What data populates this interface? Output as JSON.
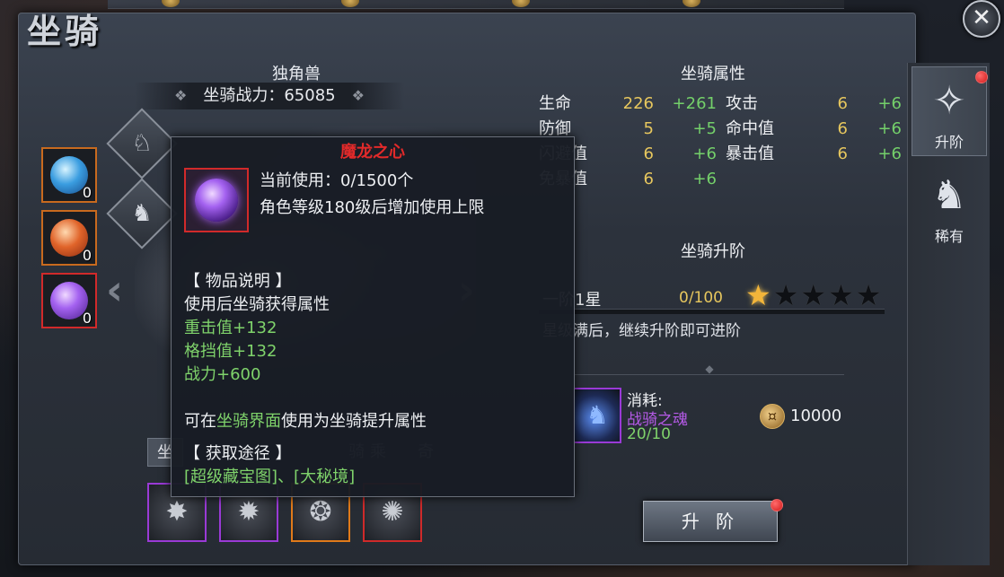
{
  "window": {
    "title": "坐骑",
    "close_glyph": "✕"
  },
  "colors": {
    "accent_gold": "#e7c75e",
    "bonus_green": "#74d06a",
    "tooltip_title_red": "#e22a2a",
    "notification_red": "#d21a1a"
  },
  "tabs": [
    {
      "label": "升阶",
      "icon": "rank-up-icon",
      "active": true,
      "badge": true
    },
    {
      "label": "稀有",
      "icon": "unicorn-icon",
      "active": false,
      "badge": false
    }
  ],
  "mount": {
    "name": "独角兽",
    "power_label": "坐骑战力：65085"
  },
  "consumables": [
    {
      "icon": "blue-orb-icon",
      "count": "0"
    },
    {
      "icon": "orange-orb-icon",
      "count": "0"
    },
    {
      "icon": "purple-orb-icon",
      "count": "0"
    }
  ],
  "mode_tabs": [
    {
      "label": "坐",
      "active": true
    },
    {
      "label": "骑 乘",
      "active": false
    },
    {
      "label": "奇",
      "active": false
    }
  ],
  "skills": [
    {
      "icon": "wolf-skill-icon",
      "rarity": "purple"
    },
    {
      "icon": "beast-skill-icon",
      "rarity": "purple"
    },
    {
      "icon": "wings-skill-icon",
      "rarity": "orange"
    },
    {
      "icon": "dragon-skill-icon",
      "rarity": "red"
    }
  ],
  "attributes": {
    "title": "坐骑属性",
    "left": [
      {
        "label": "生命",
        "value": "226",
        "bonus": "+261"
      },
      {
        "label": "防御",
        "value": "5",
        "bonus": "+5"
      },
      {
        "label": "闪避值",
        "value": "6",
        "bonus": "+6"
      },
      {
        "label": "免暴值",
        "value": "6",
        "bonus": "+6"
      }
    ],
    "right": [
      {
        "label": "攻击",
        "value": "6",
        "bonus": "+6"
      },
      {
        "label": "命中值",
        "value": "6",
        "bonus": "+6"
      },
      {
        "label": "暴击值",
        "value": "6",
        "bonus": "+6"
      }
    ]
  },
  "upgrade": {
    "title": "坐骑升阶",
    "rank": "一阶1星",
    "progress": "0/100",
    "stars_filled": 1,
    "stars_total": 5,
    "hint": "星级满后，继续升阶即可进阶",
    "cost_label": "消耗:",
    "cost_item": "战骑之魂",
    "cost_amount": "20/10",
    "gold": "10000",
    "button": "升 阶"
  },
  "tooltip": {
    "title": "魔龙之心",
    "current_use": "当前使用：0/1500个",
    "limit_note": "角色等级180级后增加使用上限",
    "desc_header": "【 物品说明 】",
    "desc_line": "使用后坐骑获得属性",
    "bonus_1": "重击值+132",
    "bonus_2": "格挡值+132",
    "bonus_3": "战力+600",
    "usage_pre": "可在",
    "usage_link": "坐骑界面",
    "usage_post": "使用为坐骑提升属性",
    "source_header": "【 获取途径 】",
    "sources": "[超级藏宝图]、[大秘境]"
  }
}
